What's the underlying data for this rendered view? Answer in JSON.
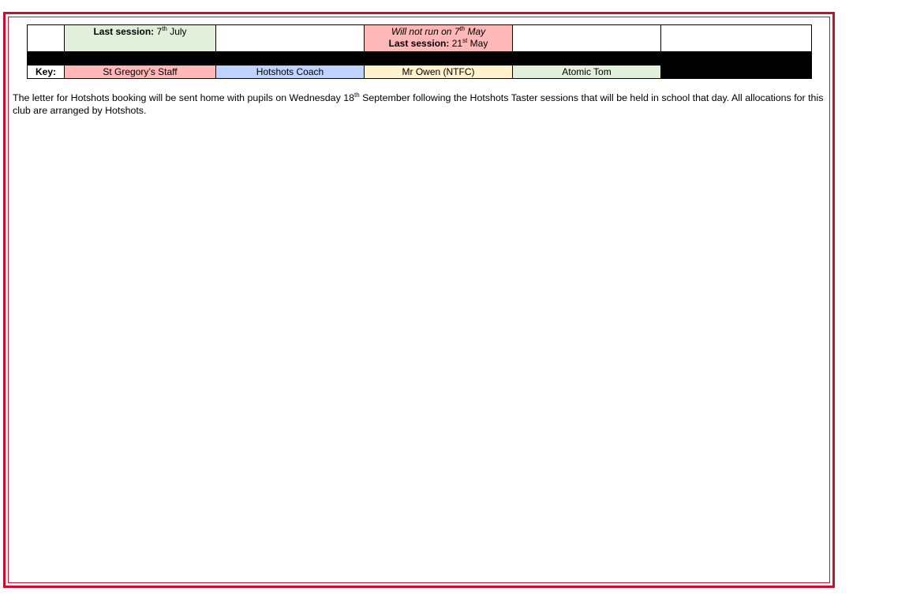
{
  "colors": {
    "frame": "#c8102e",
    "staff": "#ffb8b8",
    "coach": "#bdd4ff",
    "owen": "#fff2cc",
    "atomic": "#e2efda"
  },
  "schedule": {
    "note_green": {
      "label": "Last session:",
      "day": "7",
      "day_suffix": "th",
      "month": "July"
    },
    "note_red": {
      "line1_prefix": "Will not run on 7",
      "line1_suffix": "th",
      "line1_month": "May",
      "line2_label": "Last session:",
      "line2_day": "21",
      "line2_suffix": "st",
      "line2_month": "May"
    }
  },
  "key": {
    "label": "Key:",
    "items": [
      {
        "text": "St Gregory’s Staff"
      },
      {
        "text": "Hotshots Coach"
      },
      {
        "text": "Mr Owen (NTFC)"
      },
      {
        "text": "Atomic Tom"
      }
    ]
  },
  "paragraph": {
    "part1": "The letter for Hotshots booking will be sent home with pupils on Wednesday 18",
    "suffix": "th",
    "part2": " September following the Hotshots Taster sessions that will be held in school that day. All allocations for this club are arranged by Hotshots."
  }
}
